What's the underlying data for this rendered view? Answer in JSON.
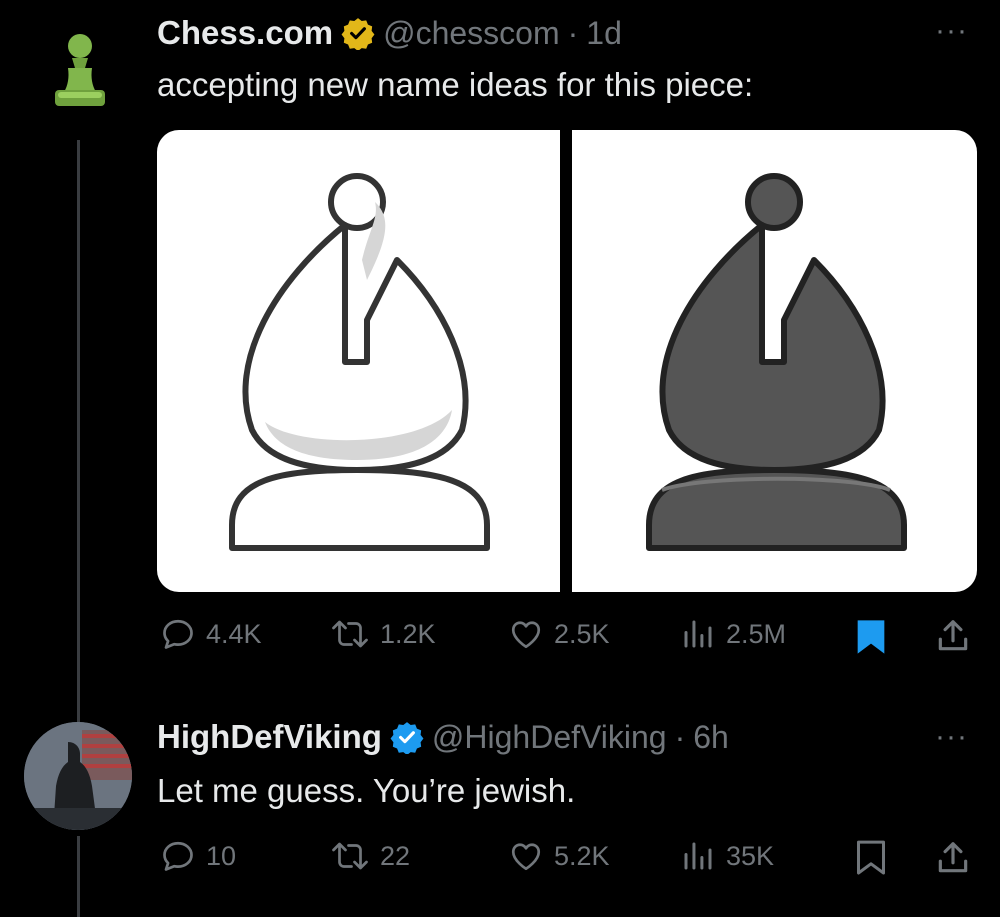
{
  "tweet1": {
    "display_name": "Chess.com",
    "handle": "@chesscom",
    "separator": "·",
    "time": "1d",
    "text": "accepting new name ideas for this piece:",
    "verified_badge": "gold-checkmark",
    "avatar_icon": "pawn-icon",
    "media": [
      "white-bishop-icon",
      "black-bishop-icon"
    ],
    "actions": {
      "replies": "4.4K",
      "reposts": "1.2K",
      "likes": "2.5K",
      "views": "2.5M",
      "bookmarked": true
    }
  },
  "tweet2": {
    "display_name": "HighDefViking",
    "handle": "@HighDefViking",
    "separator": "·",
    "time": "6h",
    "text": "Let me guess. You’re jewish.",
    "verified_badge": "blue-checkmark",
    "actions": {
      "replies": "10",
      "reposts": "22",
      "likes": "5.2K",
      "views": "35K",
      "bookmarked": false
    }
  },
  "more_label": "···",
  "colors": {
    "background": "#000000",
    "text": "#e7e9ea",
    "muted": "#71767b",
    "accent": "#1d9bf0",
    "gold": "#e2b719",
    "chess_green": "#81b64c"
  }
}
